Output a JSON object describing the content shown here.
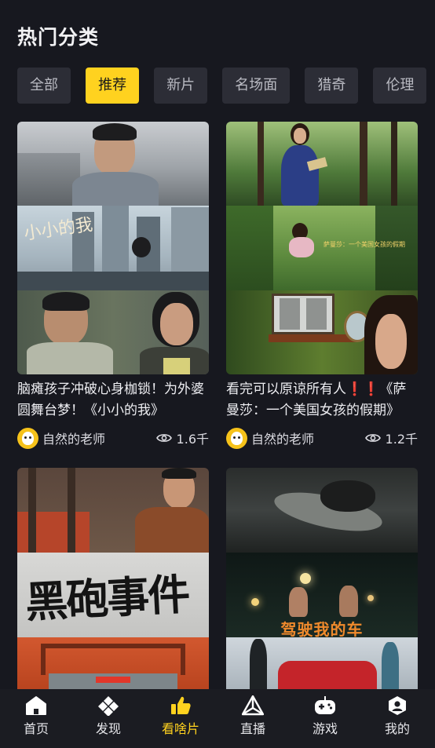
{
  "header": {
    "title": "热门分类"
  },
  "categories": [
    {
      "label": "全部",
      "active": false
    },
    {
      "label": "推荐",
      "active": true
    },
    {
      "label": "新片",
      "active": false
    },
    {
      "label": "名场面",
      "active": false
    },
    {
      "label": "猎奇",
      "active": false
    },
    {
      "label": "伦理",
      "active": false
    },
    {
      "label": "",
      "active": false
    }
  ],
  "videos": [
    {
      "title": "脑瘫孩子冲破心身枷锁！为外婆圆舞台梦！《小小的我》",
      "author": "自然的老师",
      "views": "1.6千",
      "overlay_text": "小小的我"
    },
    {
      "title": "看完可以原谅所有人❗❗《萨曼莎：一个美国女孩的假期》",
      "author": "自然的老师",
      "views": "1.2千",
      "overlay_text": "萨曼莎：一个美国女孩的假期"
    },
    {
      "title": "",
      "author": "",
      "views": "",
      "overlay_text": "黑砲事件"
    },
    {
      "title": "",
      "author": "",
      "views": "",
      "overlay_text": "驾驶我的车"
    }
  ],
  "tabbar": [
    {
      "label": "首页",
      "icon": "home-icon",
      "active": false
    },
    {
      "label": "发现",
      "icon": "discover-icon",
      "active": false
    },
    {
      "label": "看啥片",
      "icon": "thumbs-up-icon",
      "active": true
    },
    {
      "label": "直播",
      "icon": "live-icon",
      "active": false
    },
    {
      "label": "游戏",
      "icon": "gamepad-icon",
      "active": false
    },
    {
      "label": "我的",
      "icon": "profile-icon",
      "active": false
    }
  ],
  "colors": {
    "background": "#17181f",
    "accent": "#ffd21f",
    "chip_background": "#2c2d36",
    "tabbar_background": "#1b1c22"
  }
}
